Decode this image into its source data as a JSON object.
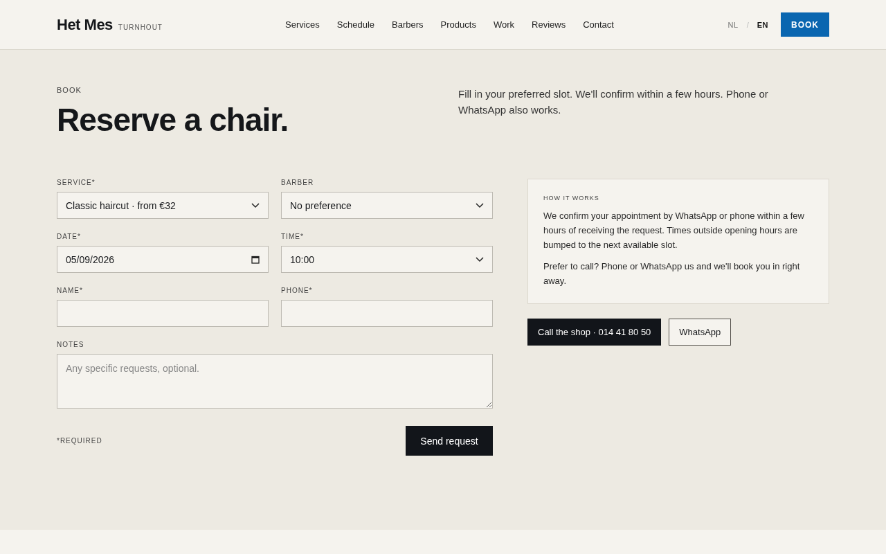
{
  "header": {
    "brand": "Het Mes",
    "location": "TURNHOUT",
    "nav": [
      {
        "label": "Services"
      },
      {
        "label": "Schedule"
      },
      {
        "label": "Barbers"
      },
      {
        "label": "Products"
      },
      {
        "label": "Work"
      },
      {
        "label": "Reviews"
      },
      {
        "label": "Contact"
      }
    ],
    "languages": [
      {
        "label": "NL",
        "selected": false
      },
      {
        "label": "EN",
        "selected": true
      }
    ],
    "language_separator": "/",
    "book_button": "BOOK"
  },
  "hero": {
    "eyebrow": "BOOK",
    "title": "Reserve a chair.",
    "intro": "Fill in your preferred slot. We'll confirm within a few hours. Phone or WhatsApp also works."
  },
  "form": {
    "fields": [
      {
        "kind": "select",
        "label": "SERVICE*",
        "value": "Classic haircut · from €32"
      },
      {
        "kind": "select",
        "label": "BARBER",
        "value": "No preference"
      },
      {
        "kind": "date",
        "label": "DATE*",
        "value": "05/09/2026"
      },
      {
        "kind": "select",
        "label": "TIME*",
        "value": "10:00"
      },
      {
        "kind": "text",
        "label": "NAME*"
      },
      {
        "kind": "text",
        "label": "PHONE*"
      },
      {
        "kind": "textarea",
        "label": "NOTES",
        "placeholder": "Any specific requests, optional."
      }
    ],
    "required_note": "*REQUIRED",
    "submit": "Send request"
  },
  "info": {
    "title": "HOW IT WORKS",
    "paragraphs": [
      "We confirm your appointment by WhatsApp or phone within a few hours of receiving the request. Times outside opening hours are bumped to the next available slot.",
      "Prefer to call? Phone or WhatsApp us and we'll book you in right away."
    ],
    "buttons": [
      {
        "kind": "primary",
        "label": "Call the shop · 014 41 80 50"
      },
      {
        "kind": "secondary",
        "label": "WhatsApp"
      }
    ]
  }
}
